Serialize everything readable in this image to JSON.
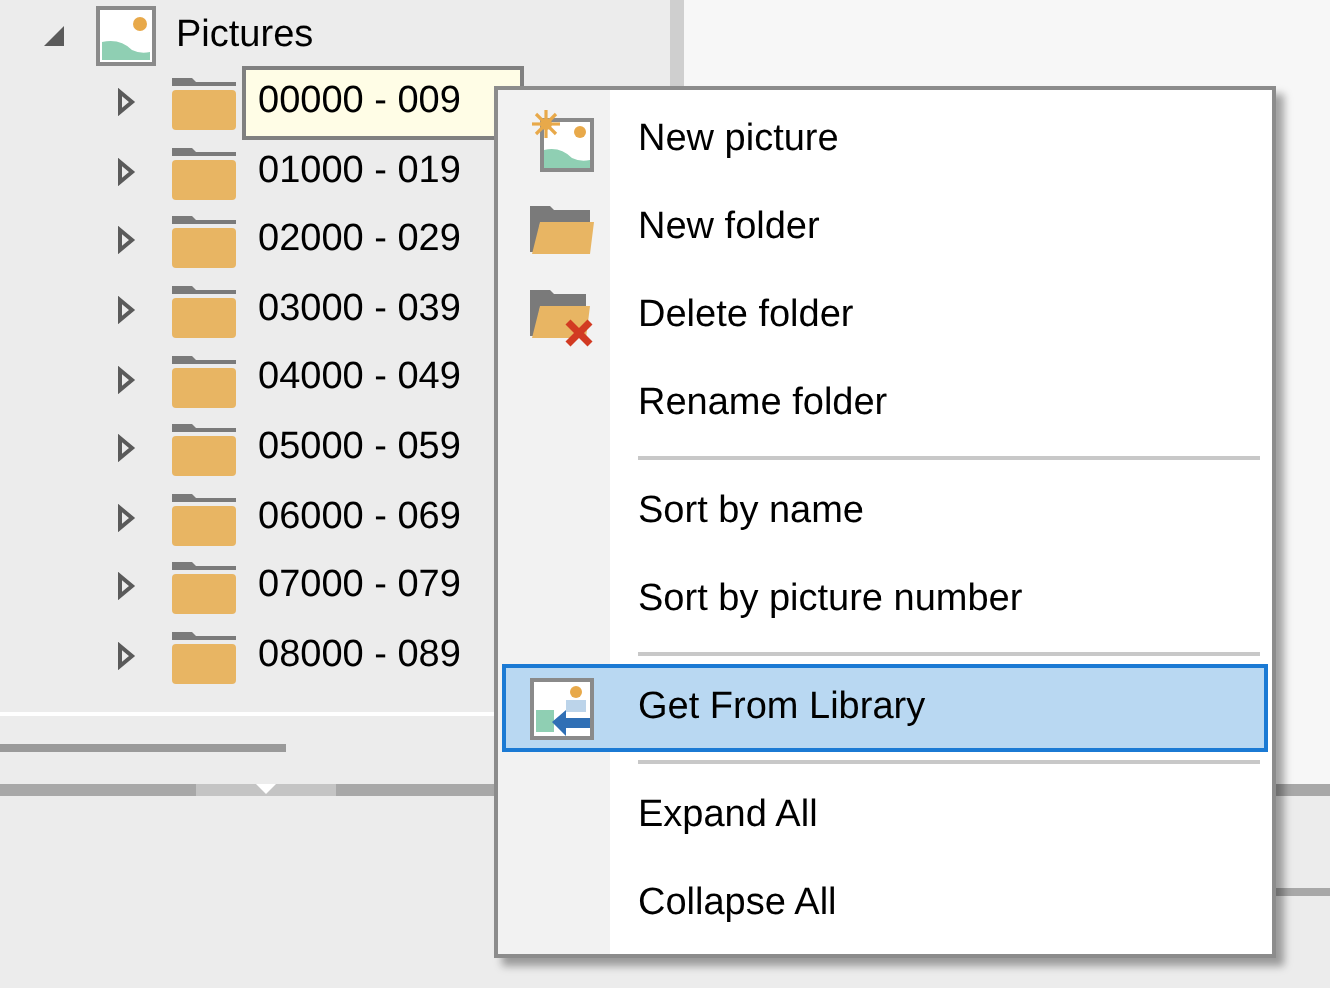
{
  "tree": {
    "label": "Pictures",
    "expanded": true,
    "children": [
      {
        "label": "00000 - 009",
        "expanded": false,
        "selected": true
      },
      {
        "label": "01000 - 019",
        "expanded": false,
        "selected": false
      },
      {
        "label": "02000 - 029",
        "expanded": false,
        "selected": false
      },
      {
        "label": "03000 - 039",
        "expanded": false,
        "selected": false
      },
      {
        "label": "04000 - 049",
        "expanded": false,
        "selected": false
      },
      {
        "label": "05000 - 059",
        "expanded": false,
        "selected": false
      },
      {
        "label": "06000 - 069",
        "expanded": false,
        "selected": false
      },
      {
        "label": "07000 - 079",
        "expanded": false,
        "selected": false
      },
      {
        "label": "08000 - 089",
        "expanded": false,
        "selected": false
      }
    ]
  },
  "context_menu": [
    {
      "kind": "item",
      "label": "New picture",
      "selected": false
    },
    {
      "kind": "item",
      "label": "New folder",
      "selected": false
    },
    {
      "kind": "item",
      "label": "Delete folder",
      "selected": false
    },
    {
      "kind": "item",
      "label": "Rename folder",
      "selected": false
    },
    {
      "kind": "separator"
    },
    {
      "kind": "item",
      "label": "Sort by name",
      "selected": false
    },
    {
      "kind": "item",
      "label": "Sort by picture number",
      "selected": false
    },
    {
      "kind": "separator"
    },
    {
      "kind": "item",
      "label": "Get From Library",
      "selected": true
    },
    {
      "kind": "separator"
    },
    {
      "kind": "item",
      "label": "Expand All",
      "selected": false
    },
    {
      "kind": "item",
      "label": "Collapse All",
      "selected": false
    }
  ]
}
